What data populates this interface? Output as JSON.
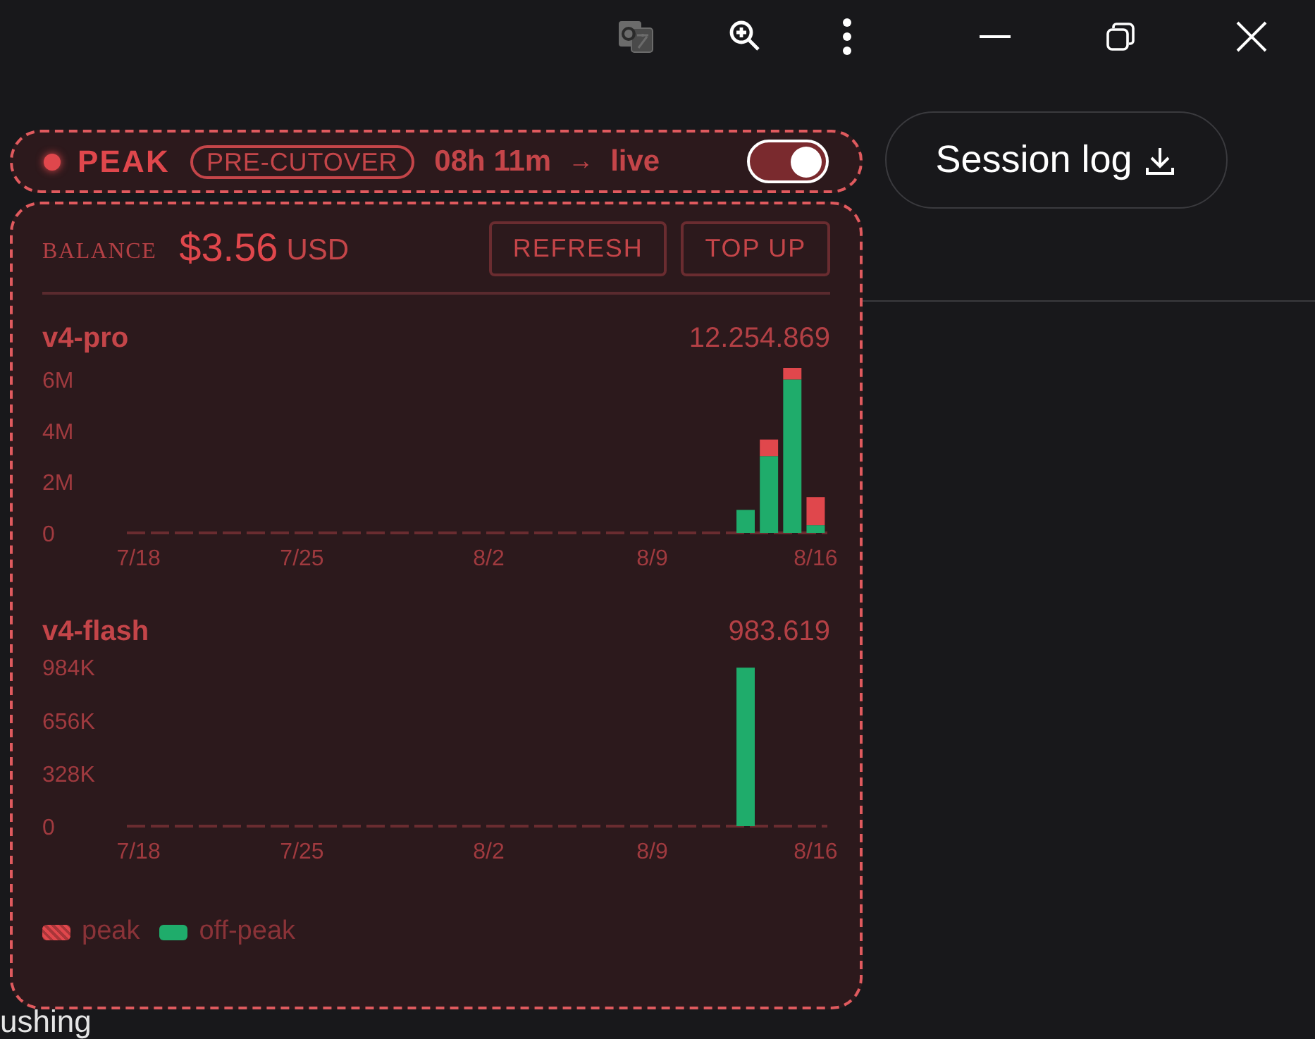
{
  "background_texts": [
    "ushing"
  ],
  "status_pill": {
    "state": "PEAK",
    "badge": "PRE-CUTOVER",
    "countdown": "08h 11m",
    "arrow": "→",
    "target": "live",
    "toggle_on": true
  },
  "session_log_button": {
    "label": "Session log"
  },
  "balance": {
    "label": "BALANCE",
    "amount": "$3.56",
    "currency": "USD",
    "buttons": [
      "REFRESH",
      "TOP UP"
    ]
  },
  "models": [
    {
      "name": "v4-pro",
      "total": "12.254.869",
      "chart_data": {
        "type": "bar",
        "stacked": true,
        "categories": [
          "7/18",
          null,
          null,
          null,
          null,
          null,
          null,
          "7/25",
          null,
          null,
          null,
          null,
          null,
          null,
          null,
          "8/2",
          null,
          null,
          null,
          null,
          null,
          null,
          "8/9",
          null,
          null,
          null,
          null,
          null,
          null,
          "8/16"
        ],
        "ylim": [
          0,
          6450000
        ],
        "yticks": [
          {
            "value": 0,
            "label": "0"
          },
          {
            "value": 2000000,
            "label": "2M"
          },
          {
            "value": 4000000,
            "label": "4M"
          },
          {
            "value": 6000000,
            "label": "6M"
          }
        ],
        "series": [
          {
            "color": "#1fac6b",
            "values": [
              0,
              0,
              0,
              0,
              0,
              0,
              0,
              0,
              0,
              0,
              0,
              0,
              0,
              0,
              0,
              0,
              0,
              0,
              0,
              0,
              0,
              0,
              0,
              0,
              0,
              0,
              900000,
              3000000,
              6000000,
              300000
            ]
          },
          {
            "color": "#e0474c",
            "values": [
              0,
              0,
              0,
              0,
              0,
              0,
              0,
              0,
              0,
              0,
              0,
              0,
              0,
              0,
              0,
              0,
              0,
              0,
              0,
              0,
              0,
              0,
              0,
              0,
              0,
              0,
              0,
              650000,
              450000,
              1100000
            ]
          }
        ]
      }
    },
    {
      "name": "v4-flash",
      "total": "983.619",
      "chart_data": {
        "type": "bar",
        "stacked": true,
        "categories": [
          "7/18",
          null,
          null,
          null,
          null,
          null,
          null,
          "7/25",
          null,
          null,
          null,
          null,
          null,
          null,
          null,
          "8/2",
          null,
          null,
          null,
          null,
          null,
          null,
          "8/9",
          null,
          null,
          null,
          null,
          null,
          null,
          "8/16"
        ],
        "ylim": [
          0,
          1020000
        ],
        "yticks": [
          {
            "value": 0,
            "label": "0"
          },
          {
            "value": 328000,
            "label": "328K"
          },
          {
            "value": 656000,
            "label": "656K"
          },
          {
            "value": 984000,
            "label": "984K"
          }
        ],
        "series": [
          {
            "color": "#1fac6b",
            "values": [
              0,
              0,
              0,
              0,
              0,
              0,
              0,
              0,
              0,
              0,
              0,
              0,
              0,
              0,
              0,
              0,
              0,
              0,
              0,
              0,
              0,
              0,
              0,
              0,
              0,
              0,
              980000,
              0,
              0,
              0
            ]
          }
        ]
      }
    }
  ],
  "legend": [
    {
      "label": "peak",
      "color": "#e0474c",
      "kind": "hatched"
    },
    {
      "label": "off-peak",
      "color": "#1fac6b",
      "kind": "solid"
    }
  ]
}
